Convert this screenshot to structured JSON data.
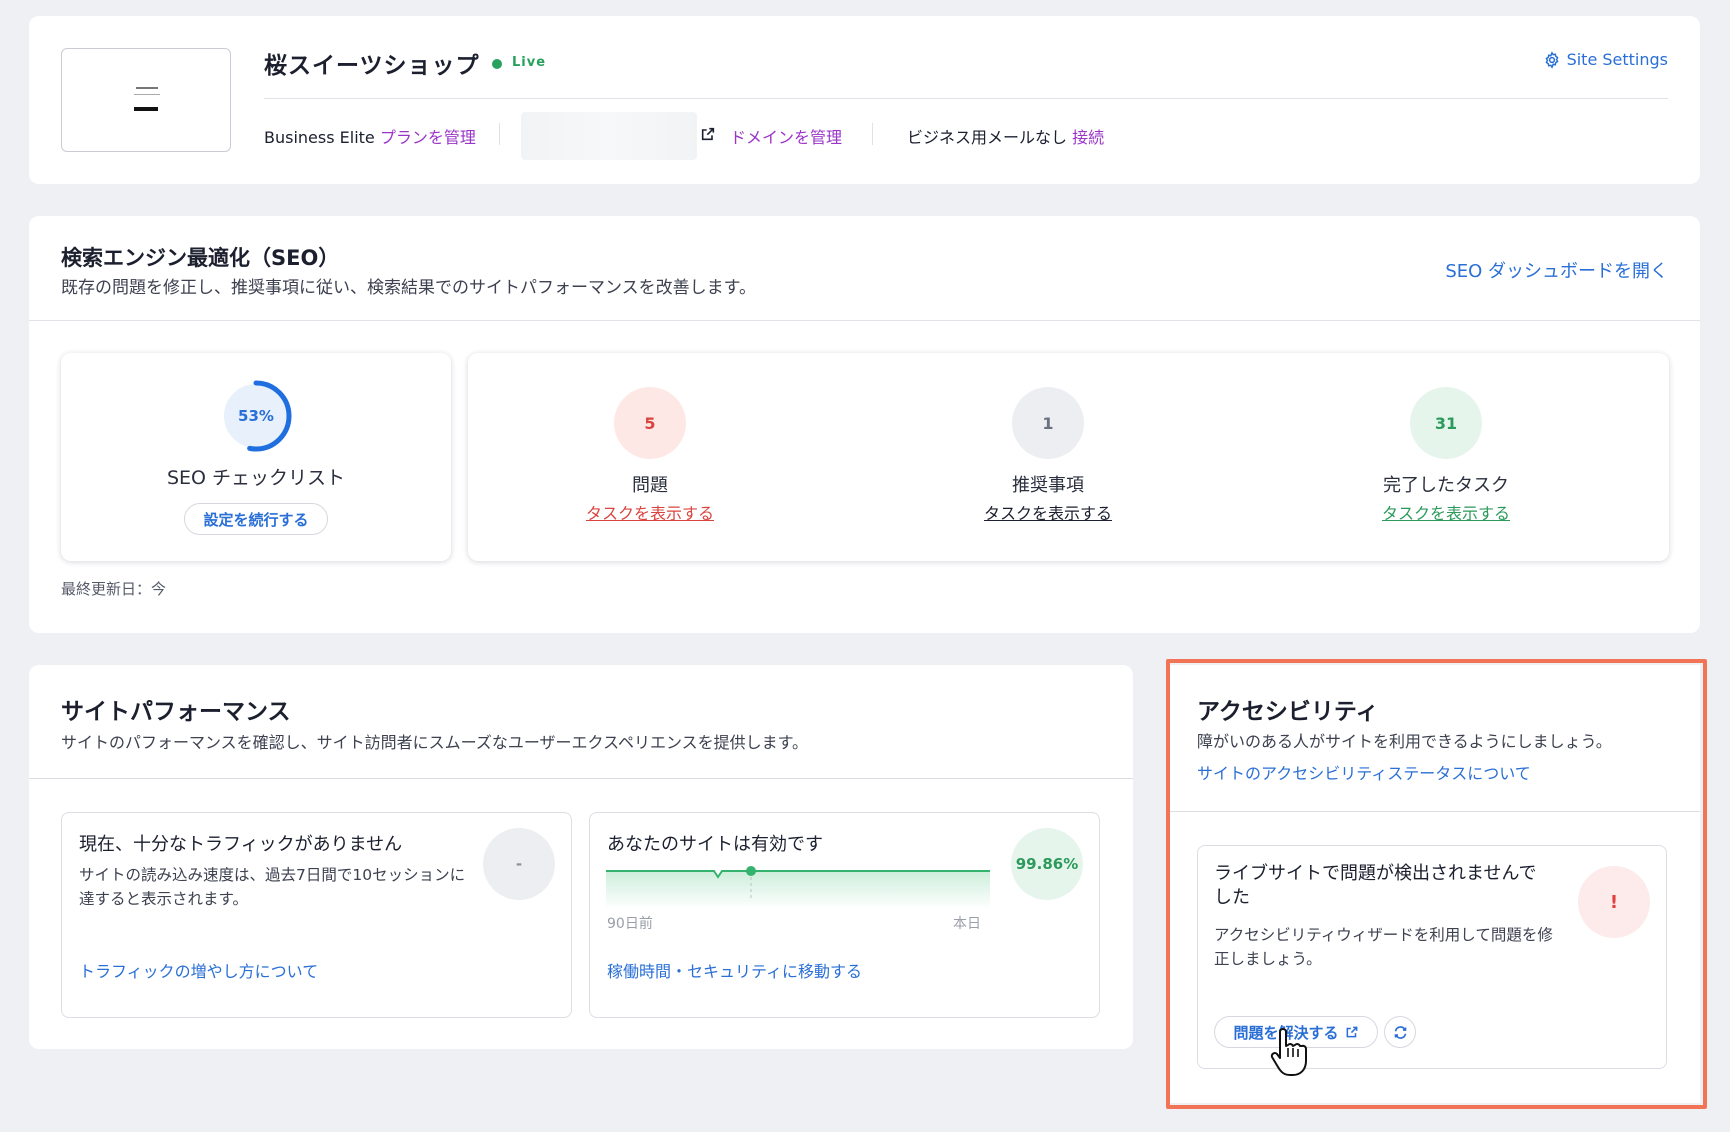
{
  "site": {
    "name": "桜スイーツショップ",
    "status": "Live",
    "settings_label": "Site Settings",
    "plan": "Business Elite",
    "plan_link": "プランを管理",
    "domain_link": "ドメインを管理",
    "email_text": "ビジネス用メールなし",
    "email_link": "接続"
  },
  "seo": {
    "title": "検索エンジン最適化（SEO）",
    "subtitle": "既存の問題を修正し、推奨事項に従い、検索結果でのサイトパフォーマンスを改善します。",
    "open_dashboard": "SEO ダッシュボードを開く",
    "checklist": {
      "percent_label": "53%",
      "percent_value": 0.53,
      "title": "SEO チェックリスト",
      "continue_button": "設定を続行する"
    },
    "stats": [
      {
        "value": "5",
        "label": "問題",
        "link": "タスクを表示する",
        "color": "#d9443f",
        "bg": "#fde8e6"
      },
      {
        "value": "1",
        "label": "推奨事項",
        "link": "タスクを表示する",
        "color": "#6b7080",
        "bg": "#eceef2"
      },
      {
        "value": "31",
        "label": "完了したタスク",
        "link": "タスクを表示する",
        "color": "#2c9a5b",
        "bg": "#e6f5ec"
      }
    ],
    "last_updated": "最終更新日：今"
  },
  "performance": {
    "title": "サイトパフォーマンス",
    "subtitle": "サイトのパフォーマンスを確認し、サイト訪問者にスムーズなユーザーエクスペリエンスを提供します。",
    "traffic": {
      "heading": "現在、十分なトラフィックがありません",
      "body": "サイトの読み込み速度は、過去7日間で10セッションに達すると表示されます。",
      "badge": "-",
      "link": "トラフィックの増やし方について"
    },
    "uptime": {
      "heading": "あなたのサイトは有効です",
      "badge": "99.86%",
      "axis_start": "90日前",
      "axis_end": "本日",
      "link": "稼働時間・セキュリティに移動する"
    }
  },
  "accessibility": {
    "title": "アクセシビリティ",
    "subtitle": "障がいのある人がサイトを利用できるようにしましょう。",
    "status_link": "サイトのアクセシビリティステータスについて",
    "box": {
      "heading": "ライブサイトで問題が検出されませんでした",
      "body": "アクセシビリティウィザードを利用して問題を修正しましょう。",
      "badge": "!",
      "fix_button": "問題を解決する"
    }
  },
  "colors": {
    "accent": "#2a6fd6",
    "purple_link": "#9a35c8",
    "live_green": "#28a15f",
    "highlight": "#f27457"
  }
}
